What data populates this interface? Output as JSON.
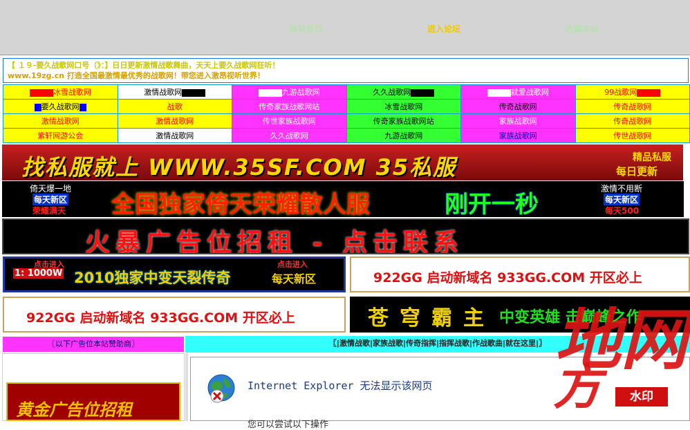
{
  "nav": {
    "home": "网站首页",
    "forum": "进入论坛",
    "bookmark": "收藏本站"
  },
  "marquee": {
    "line1": "【 １９-要久战歌网口号（》：】日日更新激情战歌舞曲，天天上要久战歌网狂听！",
    "line2": "www.19zg.cn 打造全国最激情最优秀的战歌网！带您进入激昂视听世界！"
  },
  "grid": [
    [
      {
        "text": "冰雪战歌网",
        "bg": "#ffff00",
        "color": "#ff0000",
        "pre": "#ff0000"
      },
      {
        "text": "激情战歌网",
        "bg": "#ffffff",
        "color": "#000000",
        "post": "#000000"
      },
      {
        "text": "九游战歌网",
        "bg": "#ff33ff",
        "color": "#ffffff",
        "pre": "#ffffff"
      },
      {
        "text": "久久战歌网",
        "bg": "#33ff33",
        "color": "#000000",
        "post": "#000000"
      },
      {
        "text": "就爱战歌网",
        "bg": "#ff33ff",
        "color": "#ffffff",
        "pre": "#ffffff"
      },
      {
        "text": "99战歌网",
        "bg": "#ffff00",
        "color": "#ff0000",
        "post": "#ff0000"
      }
    ],
    [
      {
        "text": "要久战歌网",
        "bg": "#ffff00",
        "color": "#000000",
        "pre": "#0000ff",
        "post": "#0000ff",
        "small": true
      },
      {
        "text": "战歌",
        "bg": "#ffff00",
        "color": "#ff0000"
      },
      {
        "text": "传奇家族战歌网站",
        "bg": "#ff33ff",
        "color": "#ffffff"
      },
      {
        "text": "冰雪战歌网",
        "bg": "#33ff33",
        "color": "#000000"
      },
      {
        "text": "传奇战歌网",
        "bg": "#ff33ff",
        "color": "#000000"
      },
      {
        "text": "传奇战歌网",
        "bg": "#ffff00",
        "color": "#ff0000"
      }
    ],
    [
      {
        "text": "激情战歌网",
        "bg": "#ffff00",
        "color": "#ff0000"
      },
      {
        "text": "激情战歌网",
        "bg": "#ffff00",
        "color": "#ff0000"
      },
      {
        "text": "传世家族战歌网",
        "bg": "#ff33ff",
        "color": "#ffffff"
      },
      {
        "text": "传奇家族战歌网站",
        "bg": "#33ff33",
        "color": "#000000"
      },
      {
        "text": "家族战歌网",
        "bg": "#ff33ff",
        "color": "#ffffff"
      },
      {
        "text": "传奇战歌网",
        "bg": "#ffff00",
        "color": "#ff0000"
      }
    ],
    [
      {
        "text": "紫轩网游公会",
        "bg": "#ffff00",
        "color": "#ff0000"
      },
      {
        "text": "激情战歌网",
        "bg": "#ffffff",
        "color": "#000000"
      },
      {
        "text": "久久战歌网",
        "bg": "#ff33ff",
        "color": "#ffffff"
      },
      {
        "text": "九游战歌网",
        "bg": "#33ff33",
        "color": "#000000"
      },
      {
        "text": "家族战歌网",
        "bg": "#ff33ff",
        "color": "#0000c0"
      },
      {
        "text": "传世战歌网",
        "bg": "#ffff00",
        "color": "#ff0000"
      }
    ]
  ],
  "banners": {
    "b1": {
      "main": "找私服就上 WWW.35SF.COM 35私服",
      "tag1": "精品私服",
      "tag2": "每日更新"
    },
    "b2": {
      "left1": "倚天爆一地",
      "left2": "每天新区",
      "left3": "荣耀满天",
      "main": "全国独家倚天荣耀散人服",
      "main2": "刚开一秒",
      "right1": "激情不用断",
      "right2": "每天新区",
      "right3": "每天500"
    },
    "b3": {
      "main": "火暴广告位招租 - 点击联系"
    },
    "b4": {
      "click1": "点击进入",
      "badge": "1: 1000W",
      "main": "2010独家中变天裂传奇",
      "click2": "点击进入",
      "sub": "每天新区"
    },
    "b5": {
      "main": "922GG 启动新域名 933GG.COM 开区必上"
    },
    "b6": {
      "main": "922GG 启动新域名 933GG.COM 开区必上"
    },
    "b7": {
      "main": "苍穹霸主",
      "sub": "中变英雄 击巅峰之作"
    }
  },
  "sponsor": "〖以下广告位本站赞助商〗",
  "section_nav": "〖|激情战歌|家族战歌|传奇指挥|指挥战歌|作战歌曲|就在这里|〗",
  "gold_ad": "黄金广告位招租",
  "ie_error": {
    "title": "Internet Explorer 无法显示该网页",
    "sub": "您可以尝试以下操作"
  },
  "watermark": {
    "text1": "地网",
    "text2": "方",
    "stamp": "水印"
  }
}
